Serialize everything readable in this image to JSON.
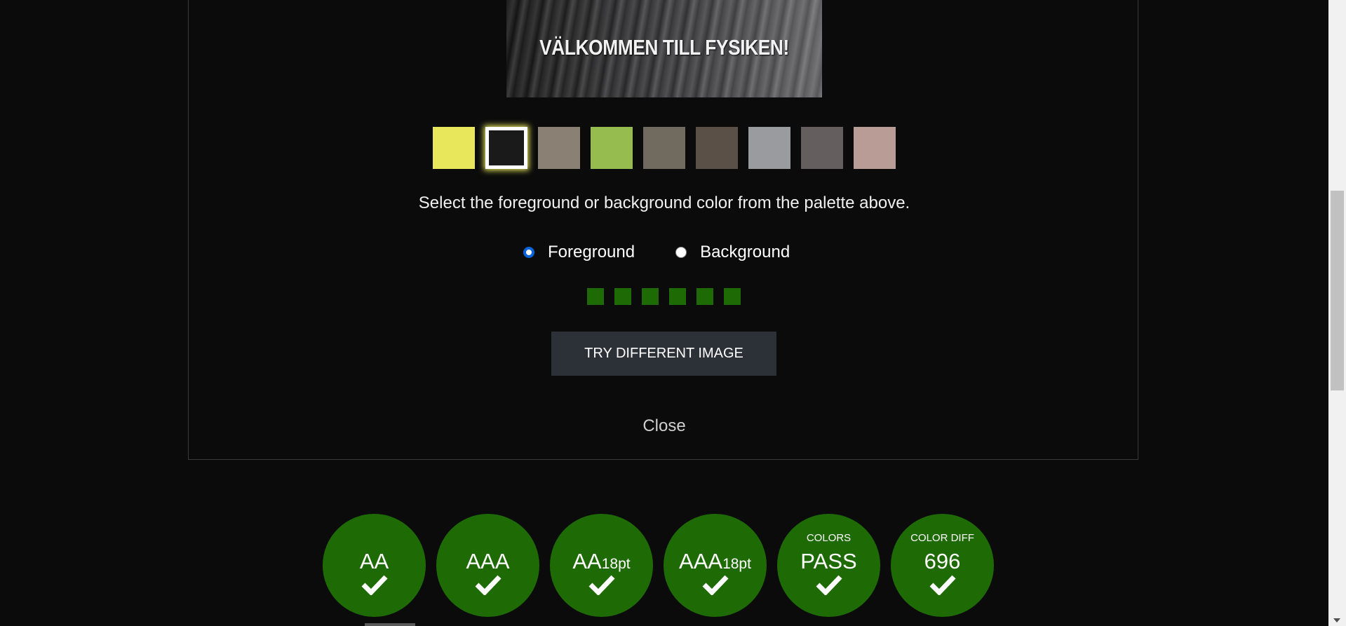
{
  "hero": {
    "caption": "VÄLKOMMEN TILL FYSIKEN!"
  },
  "palette": [
    {
      "color": "#e8e65b",
      "selected": false
    },
    {
      "color": "#1a1a1a",
      "selected": true
    },
    {
      "color": "#8a8073",
      "selected": false
    },
    {
      "color": "#96bb4e",
      "selected": false
    },
    {
      "color": "#716a5f",
      "selected": false
    },
    {
      "color": "#5a5048",
      "selected": false
    },
    {
      "color": "#9a9b9f",
      "selected": false
    },
    {
      "color": "#645e5f",
      "selected": false
    },
    {
      "color": "#b99c96",
      "selected": false
    }
  ],
  "instruction": "Select the foreground or background color from the palette above.",
  "radios": {
    "foreground_label": "Foreground",
    "background_label": "Background",
    "selected": "foreground"
  },
  "progress": {
    "count": 6,
    "color": "#1e6b06"
  },
  "try_button_label": "TRY DIFFERENT IMAGE",
  "close_label": "Close",
  "badges": [
    {
      "small": "",
      "main": "AA",
      "sub": "",
      "icon": "check-icon"
    },
    {
      "small": "",
      "main": "AAA",
      "sub": "",
      "icon": "check-icon"
    },
    {
      "small": "",
      "main": "AA",
      "sub": "18pt",
      "icon": "check-icon"
    },
    {
      "small": "",
      "main": "AAA",
      "sub": "18pt",
      "icon": "check-icon"
    },
    {
      "small": "COLORS",
      "main": "PASS",
      "sub": "",
      "icon": "check-icon"
    },
    {
      "small": "COLOR DIFF",
      "main": "696",
      "sub": "",
      "icon": "check-icon"
    }
  ],
  "colors": {
    "background": "#0b0b0b",
    "pass_green": "#1e6b06",
    "button_bg": "#2c3137",
    "radio_accent": "#0a64d8"
  }
}
